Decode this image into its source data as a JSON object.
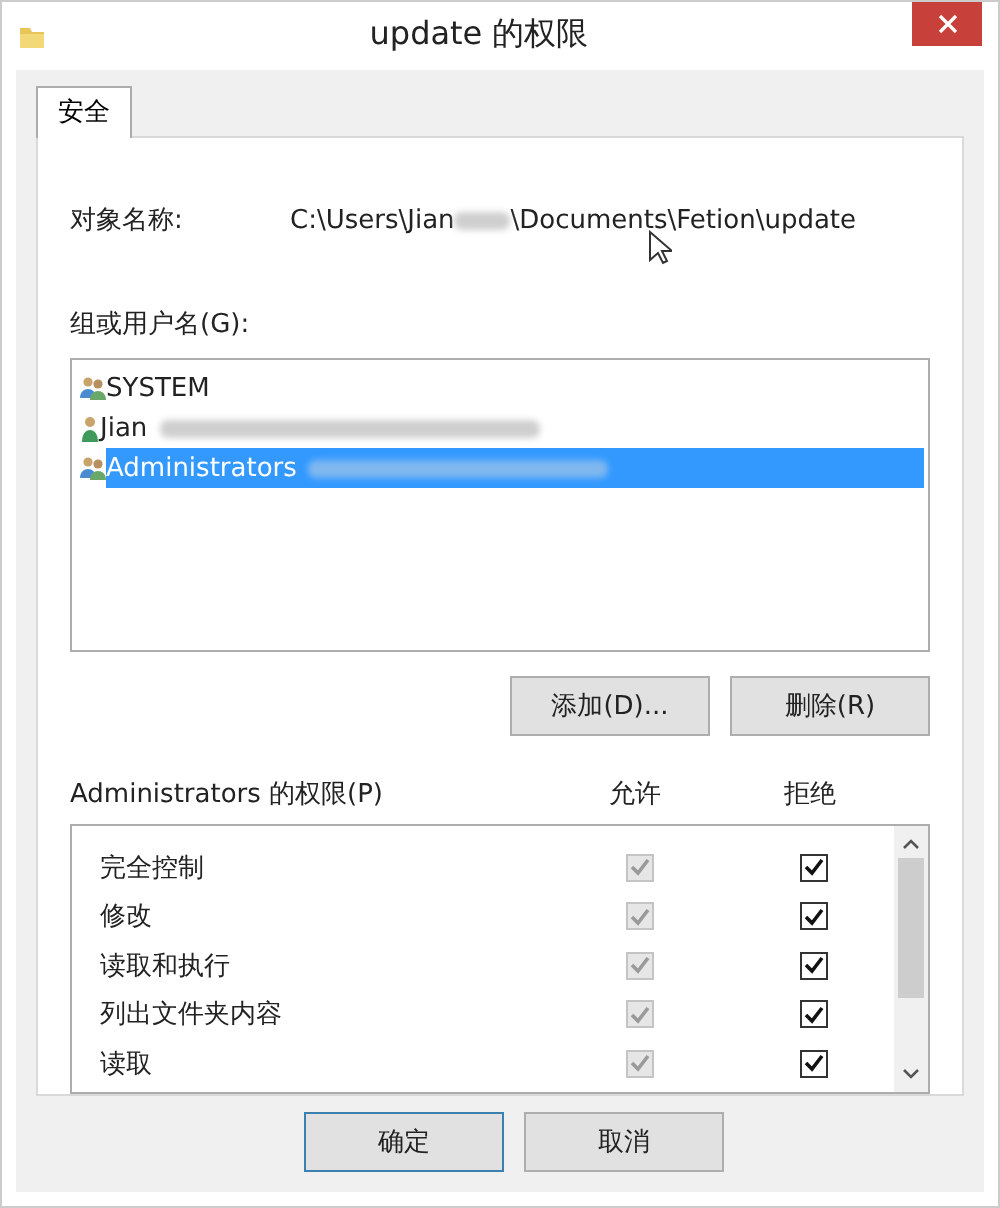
{
  "window": {
    "title": "update 的权限"
  },
  "tabs": [
    {
      "label": "安全",
      "selected": true
    }
  ],
  "object": {
    "label": "对象名称:",
    "path_start": "C:\\Users\\Jian",
    "path_end": "\\Documents\\Fetion\\update"
  },
  "groups": {
    "label": "组或用户名(G):",
    "items": [
      {
        "name": "SYSTEM",
        "kind": "group",
        "blurred": false,
        "selected": false
      },
      {
        "name": "Jian",
        "kind": "user",
        "blurred": true,
        "selected": false
      },
      {
        "name": "Administrators",
        "kind": "group",
        "blurred": true,
        "selected": true
      }
    ],
    "buttons": [
      "添加(D)...",
      "删除(R)"
    ]
  },
  "permissions": {
    "label": "Administrators 的权限(P)",
    "allow_header": "允许",
    "deny_header": "拒绝",
    "rows": [
      {
        "name": "完全控制",
        "allow": {
          "checked": true,
          "disabled": true
        },
        "deny": {
          "checked": true,
          "disabled": false
        }
      },
      {
        "name": "修改",
        "allow": {
          "checked": true,
          "disabled": true
        },
        "deny": {
          "checked": true,
          "disabled": false
        }
      },
      {
        "name": "读取和执行",
        "allow": {
          "checked": true,
          "disabled": true
        },
        "deny": {
          "checked": true,
          "disabled": false
        }
      },
      {
        "name": "列出文件夹内容",
        "allow": {
          "checked": true,
          "disabled": true
        },
        "deny": {
          "checked": true,
          "disabled": false
        }
      },
      {
        "name": "读取",
        "allow": {
          "checked": true,
          "disabled": true
        },
        "deny": {
          "checked": true,
          "disabled": false
        }
      }
    ]
  },
  "footer_buttons": [
    {
      "label": "确定",
      "default": true
    },
    {
      "label": "取消",
      "default": false
    }
  ]
}
